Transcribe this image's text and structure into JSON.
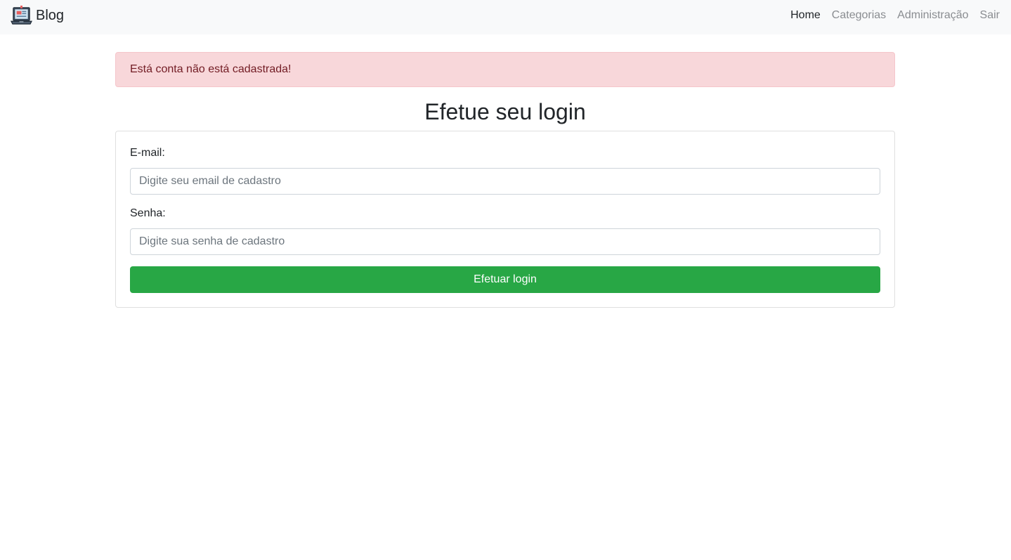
{
  "navbar": {
    "brand_label": "Blog",
    "brand_icon": "laptop-icon",
    "links": [
      {
        "label": "Home",
        "active": true
      },
      {
        "label": "Categorias",
        "active": false
      },
      {
        "label": "Administração",
        "active": false
      },
      {
        "label": "Sair",
        "active": false
      }
    ]
  },
  "alert": {
    "message": "Está conta não está cadastrada!"
  },
  "login": {
    "title": "Efetue seu login",
    "email_label": "E-mail:",
    "email_value": "",
    "email_placeholder": "Digite seu email de cadastro",
    "password_label": "Senha:",
    "password_value": "",
    "password_placeholder": "Digite sua senha de cadastro",
    "submit_label": "Efetuar login"
  },
  "colors": {
    "navbar_bg": "#f8f9fa",
    "alert_bg": "#f8d7da",
    "alert_text": "#721c24",
    "button_bg": "#28a745"
  }
}
